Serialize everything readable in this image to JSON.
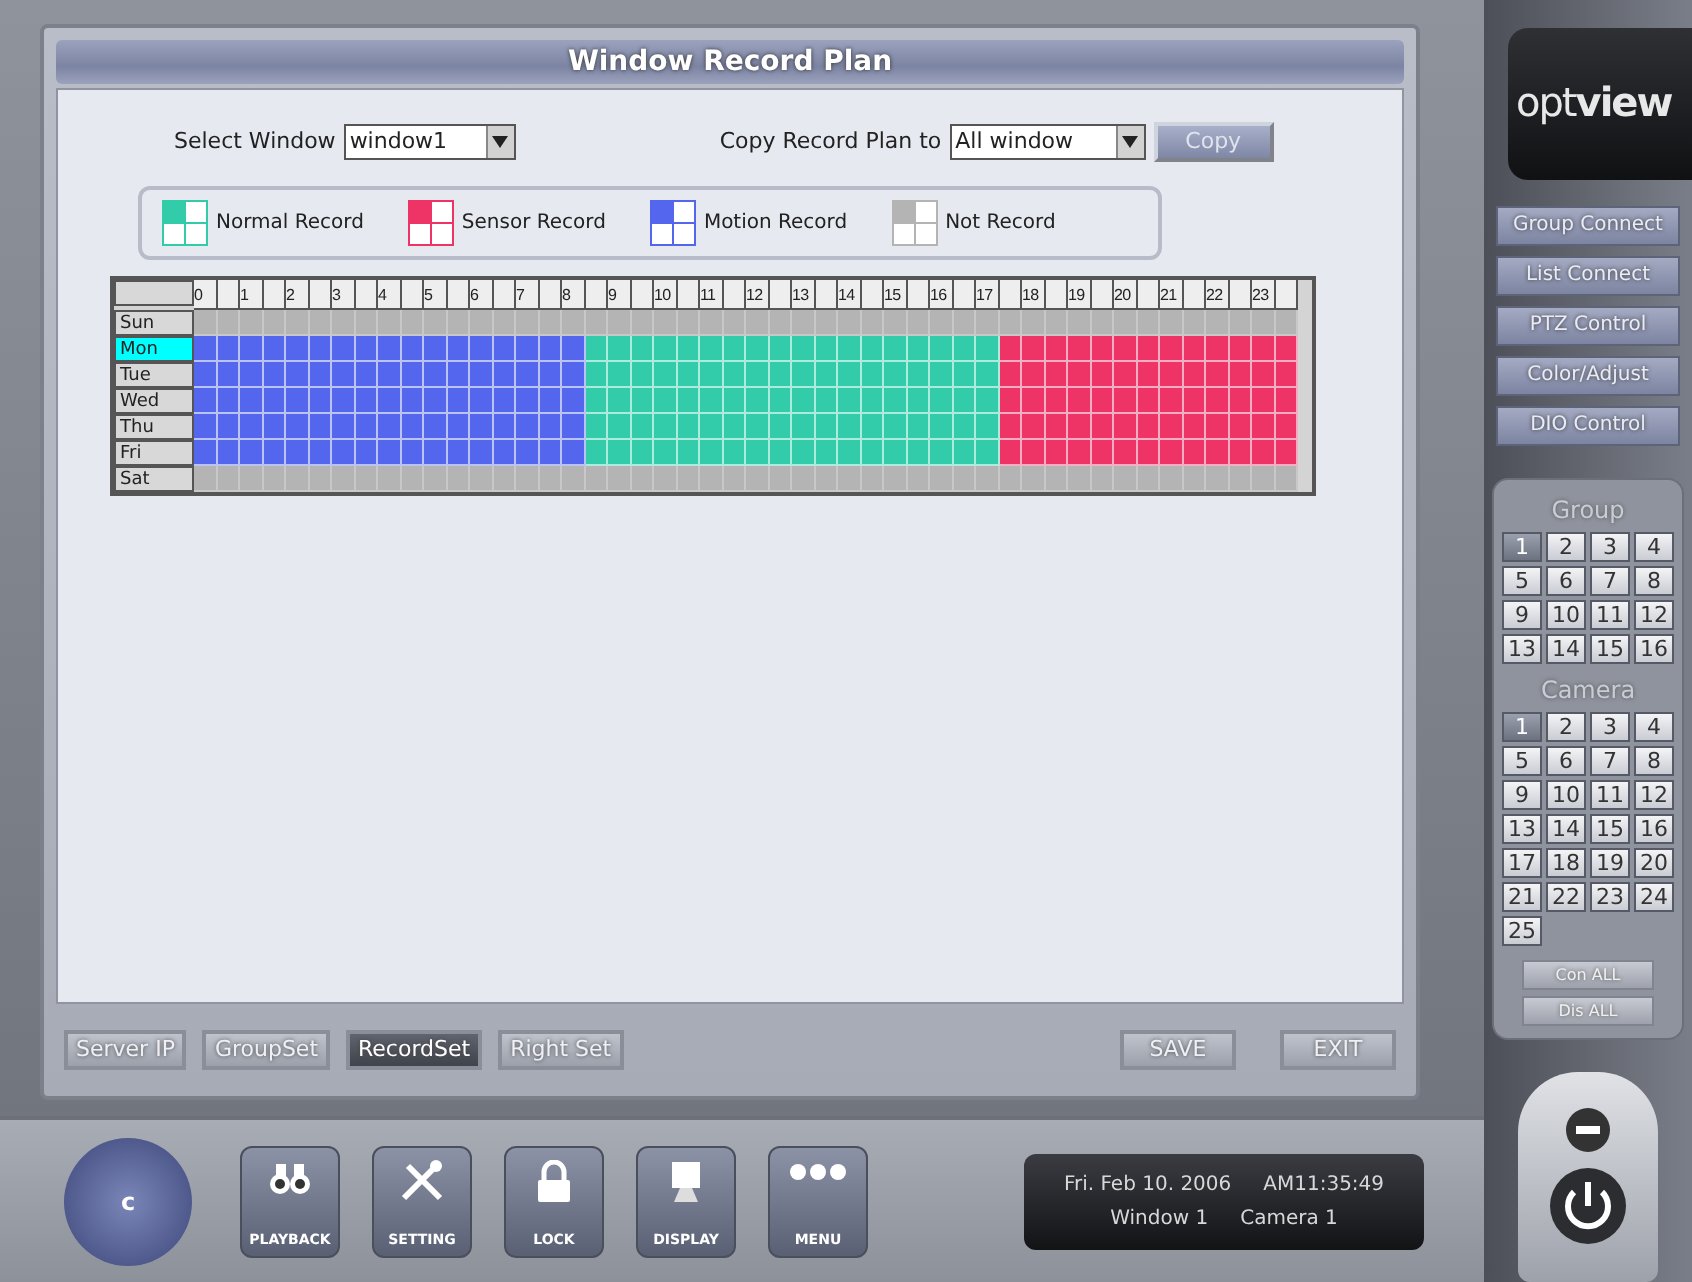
{
  "window": {
    "title": "Window Record Plan"
  },
  "select_window": {
    "label": "Select Window",
    "value": "window1"
  },
  "copy_plan": {
    "label": "Copy Record Plan to",
    "value": "All window",
    "button": "Copy"
  },
  "legend": [
    {
      "label": "Normal Record",
      "kind": "normal",
      "color": "#33ccaa"
    },
    {
      "label": "Sensor Record",
      "kind": "sensor",
      "color": "#ee3366"
    },
    {
      "label": "Motion Record",
      "kind": "motion",
      "color": "#5566ee"
    },
    {
      "label": "Not Record",
      "kind": "none",
      "color": "#b4b4b4"
    }
  ],
  "schedule": {
    "hours": [
      "0",
      "1",
      "2",
      "3",
      "4",
      "5",
      "6",
      "7",
      "8",
      "9",
      "10",
      "11",
      "12",
      "13",
      "14",
      "15",
      "16",
      "17",
      "18",
      "19",
      "20",
      "21",
      "22",
      "23"
    ],
    "days": [
      {
        "label": "Sun",
        "selected": false,
        "cells": [
          {
            "kind": "none"
          },
          {
            "kind": "none"
          },
          {
            "kind": "none"
          },
          {
            "kind": "none"
          },
          {
            "kind": "none"
          },
          {
            "kind": "none"
          },
          {
            "kind": "none"
          },
          {
            "kind": "none"
          },
          {
            "kind": "none"
          },
          {
            "kind": "none"
          },
          {
            "kind": "none"
          },
          {
            "kind": "none"
          },
          {
            "kind": "none"
          },
          {
            "kind": "none"
          },
          {
            "kind": "none"
          },
          {
            "kind": "none"
          },
          {
            "kind": "none"
          },
          {
            "kind": "none"
          },
          {
            "kind": "none"
          },
          {
            "kind": "none"
          },
          {
            "kind": "none"
          },
          {
            "kind": "none"
          },
          {
            "kind": "none"
          },
          {
            "kind": "none"
          },
          {
            "kind": "none"
          },
          {
            "kind": "none"
          },
          {
            "kind": "none"
          },
          {
            "kind": "none"
          },
          {
            "kind": "none"
          },
          {
            "kind": "none"
          },
          {
            "kind": "none"
          },
          {
            "kind": "none"
          },
          {
            "kind": "none"
          },
          {
            "kind": "none"
          },
          {
            "kind": "none"
          },
          {
            "kind": "none"
          },
          {
            "kind": "none"
          },
          {
            "kind": "none"
          },
          {
            "kind": "none"
          },
          {
            "kind": "none"
          },
          {
            "kind": "none"
          },
          {
            "kind": "none"
          },
          {
            "kind": "none"
          },
          {
            "kind": "none"
          },
          {
            "kind": "none"
          },
          {
            "kind": "none"
          },
          {
            "kind": "none"
          },
          {
            "kind": "none"
          }
        ]
      },
      {
        "label": "Mon",
        "selected": true,
        "cells": [
          {
            "kind": "motion"
          },
          {
            "kind": "motion"
          },
          {
            "kind": "motion"
          },
          {
            "kind": "motion"
          },
          {
            "kind": "motion"
          },
          {
            "kind": "motion"
          },
          {
            "kind": "motion"
          },
          {
            "kind": "motion"
          },
          {
            "kind": "motion"
          },
          {
            "kind": "motion"
          },
          {
            "kind": "motion"
          },
          {
            "kind": "motion"
          },
          {
            "kind": "motion"
          },
          {
            "kind": "motion"
          },
          {
            "kind": "motion"
          },
          {
            "kind": "motion"
          },
          {
            "kind": "motion"
          },
          {
            "kind": "normal"
          },
          {
            "kind": "normal"
          },
          {
            "kind": "normal"
          },
          {
            "kind": "normal"
          },
          {
            "kind": "normal"
          },
          {
            "kind": "normal"
          },
          {
            "kind": "normal"
          },
          {
            "kind": "normal"
          },
          {
            "kind": "normal"
          },
          {
            "kind": "normal"
          },
          {
            "kind": "normal"
          },
          {
            "kind": "normal"
          },
          {
            "kind": "normal"
          },
          {
            "kind": "normal"
          },
          {
            "kind": "normal"
          },
          {
            "kind": "normal"
          },
          {
            "kind": "normal"
          },
          {
            "kind": "normal"
          },
          {
            "kind": "sensor"
          },
          {
            "kind": "sensor"
          },
          {
            "kind": "sensor"
          },
          {
            "kind": "sensor"
          },
          {
            "kind": "sensor"
          },
          {
            "kind": "sensor"
          },
          {
            "kind": "sensor"
          },
          {
            "kind": "sensor"
          },
          {
            "kind": "sensor"
          },
          {
            "kind": "sensor"
          },
          {
            "kind": "sensor"
          },
          {
            "kind": "sensor"
          },
          {
            "kind": "sensor"
          }
        ]
      },
      {
        "label": "Tue",
        "selected": false,
        "cells": [
          {
            "kind": "motion"
          },
          {
            "kind": "motion"
          },
          {
            "kind": "motion"
          },
          {
            "kind": "motion"
          },
          {
            "kind": "motion"
          },
          {
            "kind": "motion"
          },
          {
            "kind": "motion"
          },
          {
            "kind": "motion"
          },
          {
            "kind": "motion"
          },
          {
            "kind": "motion"
          },
          {
            "kind": "motion"
          },
          {
            "kind": "motion"
          },
          {
            "kind": "motion"
          },
          {
            "kind": "motion"
          },
          {
            "kind": "motion"
          },
          {
            "kind": "motion"
          },
          {
            "kind": "motion"
          },
          {
            "kind": "normal"
          },
          {
            "kind": "normal"
          },
          {
            "kind": "normal"
          },
          {
            "kind": "normal"
          },
          {
            "kind": "normal"
          },
          {
            "kind": "normal"
          },
          {
            "kind": "normal"
          },
          {
            "kind": "normal"
          },
          {
            "kind": "normal"
          },
          {
            "kind": "normal"
          },
          {
            "kind": "normal"
          },
          {
            "kind": "normal"
          },
          {
            "kind": "normal"
          },
          {
            "kind": "normal"
          },
          {
            "kind": "normal"
          },
          {
            "kind": "normal"
          },
          {
            "kind": "normal"
          },
          {
            "kind": "normal"
          },
          {
            "kind": "sensor"
          },
          {
            "kind": "sensor"
          },
          {
            "kind": "sensor"
          },
          {
            "kind": "sensor"
          },
          {
            "kind": "sensor"
          },
          {
            "kind": "sensor"
          },
          {
            "kind": "sensor"
          },
          {
            "kind": "sensor"
          },
          {
            "kind": "sensor"
          },
          {
            "kind": "sensor"
          },
          {
            "kind": "sensor"
          },
          {
            "kind": "sensor"
          },
          {
            "kind": "sensor"
          }
        ]
      },
      {
        "label": "Wed",
        "selected": false,
        "cells": [
          {
            "kind": "motion"
          },
          {
            "kind": "motion"
          },
          {
            "kind": "motion"
          },
          {
            "kind": "motion"
          },
          {
            "kind": "motion"
          },
          {
            "kind": "motion"
          },
          {
            "kind": "motion"
          },
          {
            "kind": "motion"
          },
          {
            "kind": "motion"
          },
          {
            "kind": "motion"
          },
          {
            "kind": "motion"
          },
          {
            "kind": "motion"
          },
          {
            "kind": "motion"
          },
          {
            "kind": "motion"
          },
          {
            "kind": "motion"
          },
          {
            "kind": "motion"
          },
          {
            "kind": "motion"
          },
          {
            "kind": "normal"
          },
          {
            "kind": "normal"
          },
          {
            "kind": "normal"
          },
          {
            "kind": "normal"
          },
          {
            "kind": "normal"
          },
          {
            "kind": "normal"
          },
          {
            "kind": "normal"
          },
          {
            "kind": "normal"
          },
          {
            "kind": "normal"
          },
          {
            "kind": "normal"
          },
          {
            "kind": "normal"
          },
          {
            "kind": "normal"
          },
          {
            "kind": "normal"
          },
          {
            "kind": "normal"
          },
          {
            "kind": "normal"
          },
          {
            "kind": "normal"
          },
          {
            "kind": "normal"
          },
          {
            "kind": "normal"
          },
          {
            "kind": "sensor"
          },
          {
            "kind": "sensor"
          },
          {
            "kind": "sensor"
          },
          {
            "kind": "sensor"
          },
          {
            "kind": "sensor"
          },
          {
            "kind": "sensor"
          },
          {
            "kind": "sensor"
          },
          {
            "kind": "sensor"
          },
          {
            "kind": "sensor"
          },
          {
            "kind": "sensor"
          },
          {
            "kind": "sensor"
          },
          {
            "kind": "sensor"
          },
          {
            "kind": "sensor"
          }
        ]
      },
      {
        "label": "Thu",
        "selected": false,
        "cells": [
          {
            "kind": "motion"
          },
          {
            "kind": "motion"
          },
          {
            "kind": "motion"
          },
          {
            "kind": "motion"
          },
          {
            "kind": "motion"
          },
          {
            "kind": "motion"
          },
          {
            "kind": "motion"
          },
          {
            "kind": "motion"
          },
          {
            "kind": "motion"
          },
          {
            "kind": "motion"
          },
          {
            "kind": "motion"
          },
          {
            "kind": "motion"
          },
          {
            "kind": "motion"
          },
          {
            "kind": "motion"
          },
          {
            "kind": "motion"
          },
          {
            "kind": "motion"
          },
          {
            "kind": "motion"
          },
          {
            "kind": "normal"
          },
          {
            "kind": "normal"
          },
          {
            "kind": "normal"
          },
          {
            "kind": "normal"
          },
          {
            "kind": "normal"
          },
          {
            "kind": "normal"
          },
          {
            "kind": "normal"
          },
          {
            "kind": "normal"
          },
          {
            "kind": "normal"
          },
          {
            "kind": "normal"
          },
          {
            "kind": "normal"
          },
          {
            "kind": "normal"
          },
          {
            "kind": "normal"
          },
          {
            "kind": "normal"
          },
          {
            "kind": "normal"
          },
          {
            "kind": "normal"
          },
          {
            "kind": "normal"
          },
          {
            "kind": "normal"
          },
          {
            "kind": "sensor"
          },
          {
            "kind": "sensor"
          },
          {
            "kind": "sensor"
          },
          {
            "kind": "sensor"
          },
          {
            "kind": "sensor"
          },
          {
            "kind": "sensor"
          },
          {
            "kind": "sensor"
          },
          {
            "kind": "sensor"
          },
          {
            "kind": "sensor"
          },
          {
            "kind": "sensor"
          },
          {
            "kind": "sensor"
          },
          {
            "kind": "sensor"
          },
          {
            "kind": "sensor"
          }
        ]
      },
      {
        "label": "Fri",
        "selected": false,
        "cells": [
          {
            "kind": "motion"
          },
          {
            "kind": "motion"
          },
          {
            "kind": "motion"
          },
          {
            "kind": "motion"
          },
          {
            "kind": "motion"
          },
          {
            "kind": "motion"
          },
          {
            "kind": "motion"
          },
          {
            "kind": "motion"
          },
          {
            "kind": "motion"
          },
          {
            "kind": "motion"
          },
          {
            "kind": "motion"
          },
          {
            "kind": "motion"
          },
          {
            "kind": "motion"
          },
          {
            "kind": "motion"
          },
          {
            "kind": "motion"
          },
          {
            "kind": "motion"
          },
          {
            "kind": "motion"
          },
          {
            "kind": "normal"
          },
          {
            "kind": "normal"
          },
          {
            "kind": "normal"
          },
          {
            "kind": "normal"
          },
          {
            "kind": "normal"
          },
          {
            "kind": "normal"
          },
          {
            "kind": "normal"
          },
          {
            "kind": "normal"
          },
          {
            "kind": "normal"
          },
          {
            "kind": "normal"
          },
          {
            "kind": "normal"
          },
          {
            "kind": "normal"
          },
          {
            "kind": "normal"
          },
          {
            "kind": "normal"
          },
          {
            "kind": "normal"
          },
          {
            "kind": "normal"
          },
          {
            "kind": "normal"
          },
          {
            "kind": "normal"
          },
          {
            "kind": "sensor"
          },
          {
            "kind": "sensor"
          },
          {
            "kind": "sensor"
          },
          {
            "kind": "sensor"
          },
          {
            "kind": "sensor"
          },
          {
            "kind": "sensor"
          },
          {
            "kind": "sensor"
          },
          {
            "kind": "sensor"
          },
          {
            "kind": "sensor"
          },
          {
            "kind": "sensor"
          },
          {
            "kind": "sensor"
          },
          {
            "kind": "sensor"
          },
          {
            "kind": "sensor"
          }
        ]
      },
      {
        "label": "Sat",
        "selected": false,
        "cells": [
          {
            "kind": "none"
          },
          {
            "kind": "none"
          },
          {
            "kind": "none"
          },
          {
            "kind": "none"
          },
          {
            "kind": "none"
          },
          {
            "kind": "none"
          },
          {
            "kind": "none"
          },
          {
            "kind": "none"
          },
          {
            "kind": "none"
          },
          {
            "kind": "none"
          },
          {
            "kind": "none"
          },
          {
            "kind": "none"
          },
          {
            "kind": "none"
          },
          {
            "kind": "none"
          },
          {
            "kind": "none"
          },
          {
            "kind": "none"
          },
          {
            "kind": "none"
          },
          {
            "kind": "none"
          },
          {
            "kind": "none"
          },
          {
            "kind": "none"
          },
          {
            "kind": "none"
          },
          {
            "kind": "none"
          },
          {
            "kind": "none"
          },
          {
            "kind": "none"
          },
          {
            "kind": "none"
          },
          {
            "kind": "none"
          },
          {
            "kind": "none"
          },
          {
            "kind": "none"
          },
          {
            "kind": "none"
          },
          {
            "kind": "none"
          },
          {
            "kind": "none"
          },
          {
            "kind": "none"
          },
          {
            "kind": "none"
          },
          {
            "kind": "none"
          },
          {
            "kind": "none"
          },
          {
            "kind": "none"
          },
          {
            "kind": "none"
          },
          {
            "kind": "none"
          },
          {
            "kind": "none"
          },
          {
            "kind": "none"
          },
          {
            "kind": "none"
          },
          {
            "kind": "none"
          },
          {
            "kind": "none"
          },
          {
            "kind": "none"
          },
          {
            "kind": "none"
          },
          {
            "kind": "none"
          },
          {
            "kind": "none"
          },
          {
            "kind": "none"
          }
        ]
      }
    ]
  },
  "tabs": [
    {
      "label": "Server IP",
      "selected": false
    },
    {
      "label": "GroupSet",
      "selected": false
    },
    {
      "label": "RecordSet",
      "selected": true
    },
    {
      "label": "Right Set",
      "selected": false
    }
  ],
  "actions": [
    "SAVE",
    "EXIT"
  ],
  "joystick": {
    "label": "c"
  },
  "dock": [
    {
      "label": "PLAYBACK",
      "kind": "playback"
    },
    {
      "label": "SETTING",
      "kind": "setting"
    },
    {
      "label": "LOCK",
      "kind": "lock"
    },
    {
      "label": "DISPLAY",
      "kind": "display"
    },
    {
      "label": "MENU",
      "kind": "menu"
    }
  ],
  "status": {
    "date": "Fri. Feb 10. 2006",
    "time": "AM11:35:49",
    "window": "Window 1",
    "camera": "Camera 1"
  },
  "sidebar": {
    "logo": "opt**view**",
    "menu": [
      "Group Connect",
      "List Connect",
      "PTZ Control",
      "Color/Adjust",
      "DIO Control"
    ],
    "group_title": "Group",
    "groups": [
      {
        "label": "1",
        "selected": true
      },
      {
        "label": "2",
        "selected": false
      },
      {
        "label": "3",
        "selected": false
      },
      {
        "label": "4",
        "selected": false
      },
      {
        "label": "5",
        "selected": false
      },
      {
        "label": "6",
        "selected": false
      },
      {
        "label": "7",
        "selected": false
      },
      {
        "label": "8",
        "selected": false
      },
      {
        "label": "9",
        "selected": false
      },
      {
        "label": "10",
        "selected": false
      },
      {
        "label": "11",
        "selected": false
      },
      {
        "label": "12",
        "selected": false
      },
      {
        "label": "13",
        "selected": false
      },
      {
        "label": "14",
        "selected": false
      },
      {
        "label": "15",
        "selected": false
      },
      {
        "label": "16",
        "selected": false
      }
    ],
    "camera_title": "Camera",
    "cameras": [
      {
        "label": "1",
        "selected": true
      },
      {
        "label": "2",
        "selected": false
      },
      {
        "label": "3",
        "selected": false
      },
      {
        "label": "4",
        "selected": false
      },
      {
        "label": "5",
        "selected": false
      },
      {
        "label": "6",
        "selected": false
      },
      {
        "label": "7",
        "selected": false
      },
      {
        "label": "8",
        "selected": false
      },
      {
        "label": "9",
        "selected": false
      },
      {
        "label": "10",
        "selected": false
      },
      {
        "label": "11",
        "selected": false
      },
      {
        "label": "12",
        "selected": false
      },
      {
        "label": "13",
        "selected": false
      },
      {
        "label": "14",
        "selected": false
      },
      {
        "label": "15",
        "selected": false
      },
      {
        "label": "16",
        "selected": false
      },
      {
        "label": "17",
        "selected": false
      },
      {
        "label": "18",
        "selected": false
      },
      {
        "label": "19",
        "selected": false
      },
      {
        "label": "20",
        "selected": false
      },
      {
        "label": "21",
        "selected": false
      },
      {
        "label": "22",
        "selected": false
      },
      {
        "label": "23",
        "selected": false
      },
      {
        "label": "24",
        "selected": false
      },
      {
        "label": "25",
        "selected": false
      }
    ],
    "buttons": [
      "Con ALL",
      "Dis ALL"
    ]
  }
}
